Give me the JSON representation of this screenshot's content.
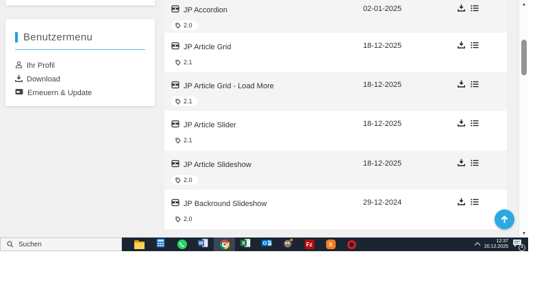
{
  "colors": {
    "accent_blue": "#1ea3dd",
    "scrolltop_blue": "#2aa9e0",
    "taskbar_bg": "#1b2531",
    "page_bg": "#f0f0f1"
  },
  "sidebar": {
    "title": "Benutzermenu",
    "items": [
      {
        "label": "Ihr Profil",
        "icon": "user-icon"
      },
      {
        "label": "Download",
        "icon": "download-icon"
      },
      {
        "label": "Erneuern & Update",
        "icon": "renew-card-icon"
      }
    ]
  },
  "list": {
    "rows": [
      {
        "name": "JP Accordion",
        "date": "02-01-2025",
        "version": "2.0"
      },
      {
        "name": "JP Article Grid",
        "date": "18-12-2025",
        "version": "2.1"
      },
      {
        "name": "JP Article Grid - Load More",
        "date": "18-12-2025",
        "version": "2.1"
      },
      {
        "name": "JP Article Slider",
        "date": "18-12-2025",
        "version": "2.1"
      },
      {
        "name": "JP Article Slideshow",
        "date": "18-12-2025",
        "version": "2.0"
      },
      {
        "name": "JP Backround Slideshow",
        "date": "29-12-2024",
        "version": "2.0"
      }
    ],
    "row_icons": [
      "module-icon",
      "tag-icon",
      "download-icon",
      "details-list-icon"
    ]
  },
  "scroll_to_top": {
    "icon": "arrow-up-icon"
  },
  "taskbar": {
    "search_label": "Suchen",
    "app_icons": [
      "file-explorer-icon",
      "calculator-icon",
      "whatsapp-icon",
      "word-icon",
      "chrome-icon",
      "excel-icon",
      "outlook-icon",
      "gimp-icon",
      "filezilla-icon",
      "xampp-icon",
      "opera-icon"
    ],
    "filezilla_label": "Fz",
    "xampp_label": "X",
    "word_label": "W",
    "excel_label": "X",
    "outlook_label": "O",
    "tray": {
      "time": "12:37",
      "date": "20.12.2025",
      "badge": "4"
    }
  }
}
